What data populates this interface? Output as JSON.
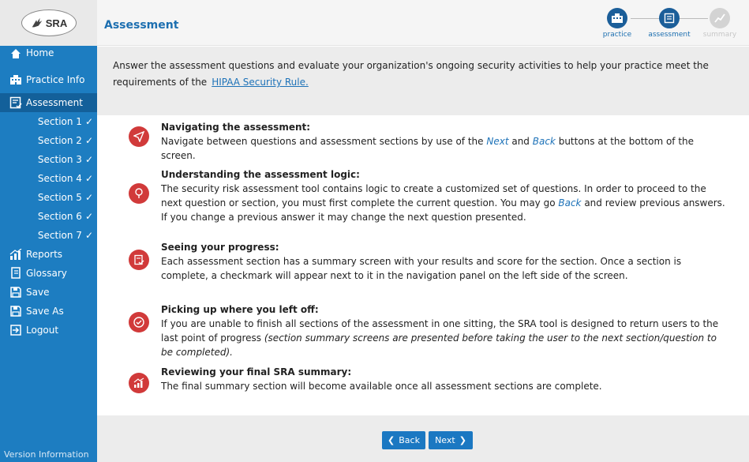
{
  "logo": {
    "text": "SRA"
  },
  "sidebar": {
    "items": [
      {
        "label": "Home",
        "icon": "home-icon"
      },
      {
        "label": "Practice Info",
        "icon": "building-icon"
      },
      {
        "label": "Assessment",
        "icon": "checklist-icon",
        "active": true
      }
    ],
    "sections": [
      {
        "label": "Section 1",
        "check": "✓"
      },
      {
        "label": "Section 2",
        "check": "✓"
      },
      {
        "label": "Section 3",
        "check": "✓"
      },
      {
        "label": "Section 4",
        "check": "✓"
      },
      {
        "label": "Section 5",
        "check": "✓"
      },
      {
        "label": "Section 6",
        "check": "✓"
      },
      {
        "label": "Section 7",
        "check": "✓"
      }
    ],
    "lower_items": [
      {
        "label": "Reports",
        "icon": "chart-icon"
      },
      {
        "label": "Glossary",
        "icon": "book-icon"
      },
      {
        "label": "Save",
        "icon": "save-icon"
      },
      {
        "label": "Save As",
        "icon": "save-as-icon"
      },
      {
        "label": "Logout",
        "icon": "logout-icon"
      }
    ],
    "version": "Version Information"
  },
  "header": {
    "title": "Assessment",
    "steps": [
      {
        "label": "practice",
        "state": "done"
      },
      {
        "label": "assessment",
        "state": "current"
      },
      {
        "label": "summary",
        "state": "pending"
      }
    ]
  },
  "intro": {
    "text": "Answer the assessment questions and evaluate your organization's ongoing security activities to help your practice meet the requirements of the",
    "link": "HIPAA Security Rule."
  },
  "items": [
    {
      "title": "Navigating the assessment:",
      "p1": "Navigate between questions and assessment sections by use of the ",
      "k1": "Next",
      "p2": " and ",
      "k2": "Back",
      "p3": " buttons at the bottom of the screen."
    },
    {
      "title": "Understanding the assessment logic:",
      "p1": "The security risk assessment tool contains logic to create a customized set of questions. In order to proceed to the next question or section, you must first complete the current question. You may go ",
      "k1": "Back",
      "p2": " and review previous answers. If you change a previous answer it may change the next question presented."
    },
    {
      "title": "Seeing your progress:",
      "p1": "Each assessment section has a summary screen with your results and score for the section. Once a section is complete, a checkmark will appear next to it in the navigation panel on the left side of the screen."
    },
    {
      "title": "Picking up where you left off:",
      "p1": "If you are unable to finish all sections of the assessment in one sitting, the SRA tool is designed to return users to the last point of progress ",
      "it": "(section summary screens are presented before taking the user to the next section/question to be completed)."
    },
    {
      "title": "Reviewing your final SRA summary:",
      "p1": "The final summary section will become available once all assessment sections are complete."
    }
  ],
  "footer": {
    "back_label": "Back",
    "next_label": "Next"
  },
  "colors": {
    "sidebar": "#1d7dc1",
    "active": "#13609a",
    "accent_red": "#d13a3a",
    "link": "#1d72b8"
  }
}
